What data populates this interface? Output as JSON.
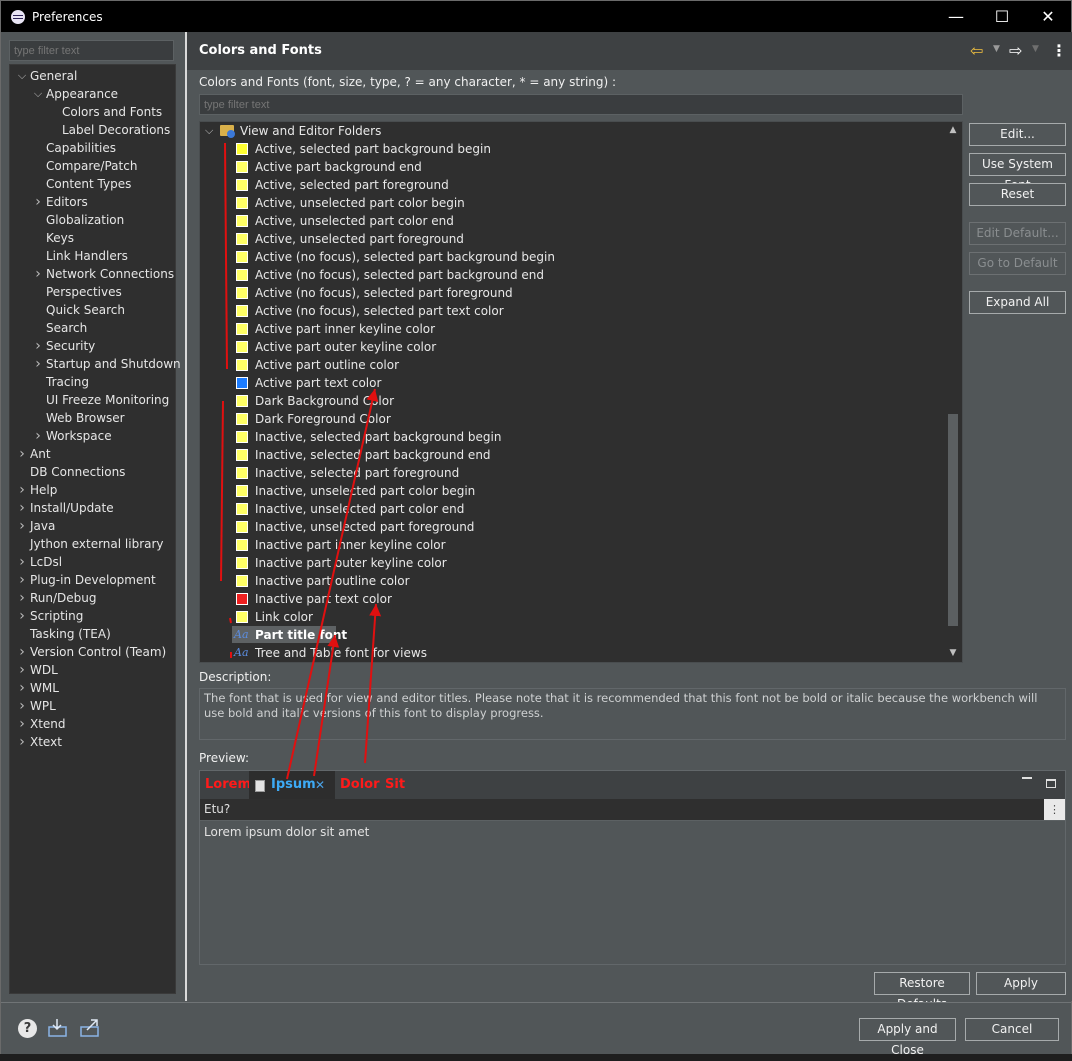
{
  "window": {
    "title": "Preferences",
    "minimize": "—",
    "maximize": "☐",
    "close": "✕"
  },
  "left": {
    "filter_placeholder": "type filter text",
    "tree": [
      {
        "label": "General",
        "level": 0,
        "chevron": "expanded"
      },
      {
        "label": "Appearance",
        "level": 1,
        "chevron": "expanded"
      },
      {
        "label": "Colors and Fonts",
        "level": 2,
        "chevron": "none"
      },
      {
        "label": "Label Decorations",
        "level": 2,
        "chevron": "none"
      },
      {
        "label": "Capabilities",
        "level": 1,
        "chevron": "none"
      },
      {
        "label": "Compare/Patch",
        "level": 1,
        "chevron": "none"
      },
      {
        "label": "Content Types",
        "level": 1,
        "chevron": "none"
      },
      {
        "label": "Editors",
        "level": 1,
        "chevron": "collapsed"
      },
      {
        "label": "Globalization",
        "level": 1,
        "chevron": "none"
      },
      {
        "label": "Keys",
        "level": 1,
        "chevron": "none"
      },
      {
        "label": "Link Handlers",
        "level": 1,
        "chevron": "none"
      },
      {
        "label": "Network Connections",
        "level": 1,
        "chevron": "collapsed"
      },
      {
        "label": "Perspectives",
        "level": 1,
        "chevron": "none"
      },
      {
        "label": "Quick Search",
        "level": 1,
        "chevron": "none"
      },
      {
        "label": "Search",
        "level": 1,
        "chevron": "none"
      },
      {
        "label": "Security",
        "level": 1,
        "chevron": "collapsed"
      },
      {
        "label": "Startup and Shutdown",
        "level": 1,
        "chevron": "collapsed"
      },
      {
        "label": "Tracing",
        "level": 1,
        "chevron": "none"
      },
      {
        "label": "UI Freeze Monitoring",
        "level": 1,
        "chevron": "none"
      },
      {
        "label": "Web Browser",
        "level": 1,
        "chevron": "none"
      },
      {
        "label": "Workspace",
        "level": 1,
        "chevron": "collapsed"
      },
      {
        "label": "Ant",
        "level": 0,
        "chevron": "collapsed"
      },
      {
        "label": "DB Connections",
        "level": 0,
        "chevron": "none"
      },
      {
        "label": "Help",
        "level": 0,
        "chevron": "collapsed"
      },
      {
        "label": "Install/Update",
        "level": 0,
        "chevron": "collapsed"
      },
      {
        "label": "Java",
        "level": 0,
        "chevron": "collapsed"
      },
      {
        "label": "Jython external library",
        "level": 0,
        "chevron": "none"
      },
      {
        "label": "LcDsl",
        "level": 0,
        "chevron": "collapsed"
      },
      {
        "label": "Plug-in Development",
        "level": 0,
        "chevron": "collapsed"
      },
      {
        "label": "Run/Debug",
        "level": 0,
        "chevron": "collapsed"
      },
      {
        "label": "Scripting",
        "level": 0,
        "chevron": "collapsed"
      },
      {
        "label": "Tasking (TEA)",
        "level": 0,
        "chevron": "none"
      },
      {
        "label": "Version Control (Team)",
        "level": 0,
        "chevron": "collapsed"
      },
      {
        "label": "WDL",
        "level": 0,
        "chevron": "collapsed"
      },
      {
        "label": "WML",
        "level": 0,
        "chevron": "collapsed"
      },
      {
        "label": "WPL",
        "level": 0,
        "chevron": "collapsed"
      },
      {
        "label": "Xtend",
        "level": 0,
        "chevron": "collapsed"
      },
      {
        "label": "Xtext",
        "level": 0,
        "chevron": "collapsed"
      }
    ]
  },
  "page": {
    "title": "Colors and Fonts",
    "section_label": "Colors and Fonts (font, size, type, ? = any character, * = any string) :",
    "filter_placeholder": "type filter text",
    "tree_root": "View and Editor Folders",
    "items": [
      {
        "label": "Active, selected part background begin",
        "kind": "color",
        "swatch": "bright-yellow"
      },
      {
        "label": "Active part background end",
        "kind": "color",
        "swatch": "yellow"
      },
      {
        "label": "Active, selected part foreground",
        "kind": "color",
        "swatch": "yellow"
      },
      {
        "label": "Active, unselected part color begin",
        "kind": "color",
        "swatch": "yellow"
      },
      {
        "label": "Active, unselected part color end",
        "kind": "color",
        "swatch": "yellow"
      },
      {
        "label": "Active, unselected part foreground",
        "kind": "color",
        "swatch": "yellow"
      },
      {
        "label": "Active (no focus), selected part background begin",
        "kind": "color",
        "swatch": "yellow"
      },
      {
        "label": "Active (no focus), selected part background end",
        "kind": "color",
        "swatch": "yellow"
      },
      {
        "label": "Active (no focus), selected part foreground",
        "kind": "color",
        "swatch": "yellow"
      },
      {
        "label": "Active (no focus), selected part text color",
        "kind": "color",
        "swatch": "yellow"
      },
      {
        "label": "Active part inner keyline color",
        "kind": "color",
        "swatch": "yellow"
      },
      {
        "label": "Active part outer keyline color",
        "kind": "color",
        "swatch": "yellow"
      },
      {
        "label": "Active part outline color",
        "kind": "color",
        "swatch": "yellow"
      },
      {
        "label": "Active part text color",
        "kind": "color",
        "swatch": "blue"
      },
      {
        "label": "Dark Background Color",
        "kind": "color",
        "swatch": "yellow"
      },
      {
        "label": "Dark Foreground Color",
        "kind": "color",
        "swatch": "yellow"
      },
      {
        "label": "Inactive, selected part background begin",
        "kind": "color",
        "swatch": "yellow"
      },
      {
        "label": "Inactive, selected part background end",
        "kind": "color",
        "swatch": "yellow"
      },
      {
        "label": "Inactive, selected part foreground",
        "kind": "color",
        "swatch": "yellow"
      },
      {
        "label": "Inactive, unselected part color begin",
        "kind": "color",
        "swatch": "yellow"
      },
      {
        "label": "Inactive, unselected part color end",
        "kind": "color",
        "swatch": "yellow"
      },
      {
        "label": "Inactive, unselected part foreground",
        "kind": "color",
        "swatch": "yellow"
      },
      {
        "label": "Inactive part inner keyline color",
        "kind": "color",
        "swatch": "yellow"
      },
      {
        "label": "Inactive part outer keyline color",
        "kind": "color",
        "swatch": "yellow"
      },
      {
        "label": "Inactive part outline color",
        "kind": "color",
        "swatch": "yellow"
      },
      {
        "label": "Inactive part text color",
        "kind": "color",
        "swatch": "red"
      },
      {
        "label": "Link color",
        "kind": "color",
        "swatch": "yellow"
      },
      {
        "label": "Part title font",
        "kind": "font",
        "selected": true
      },
      {
        "label": "Tree and Table font for views",
        "kind": "font"
      }
    ],
    "font_glyph": "Aa",
    "buttons": {
      "edit": "Edit...",
      "use_system_font": "Use System Font",
      "reset": "Reset",
      "edit_default": "Edit Default...",
      "go_to_default": "Go to Default",
      "expand_all": "Expand All"
    },
    "description_label": "Description:",
    "description": "The font that is used for view and editor titles. Please note that it is recommended that this font not be bold or italic because the workbench will use bold and italic versions of this font to display progress.",
    "preview_label": "Preview:",
    "preview": {
      "tabs": [
        "Lorem",
        "Ipsum",
        "Dolor",
        "Sit"
      ],
      "active_tab_close": "✕",
      "toolbar_text": "Etu?",
      "body_text": "Lorem ipsum dolor sit amet"
    },
    "restore_defaults": "Restore Defaults",
    "apply": "Apply"
  },
  "bottom": {
    "apply_and_close": "Apply and Close",
    "cancel": "Cancel",
    "help": "?"
  },
  "colors": {
    "swatch_yellow": "#ffff66",
    "swatch_blue": "#1c7cff",
    "swatch_red": "#ee2020",
    "preview_tab_red": "#ff1a1a",
    "preview_tab_active": "#3daaf5",
    "annotation_red": "#e01010"
  }
}
